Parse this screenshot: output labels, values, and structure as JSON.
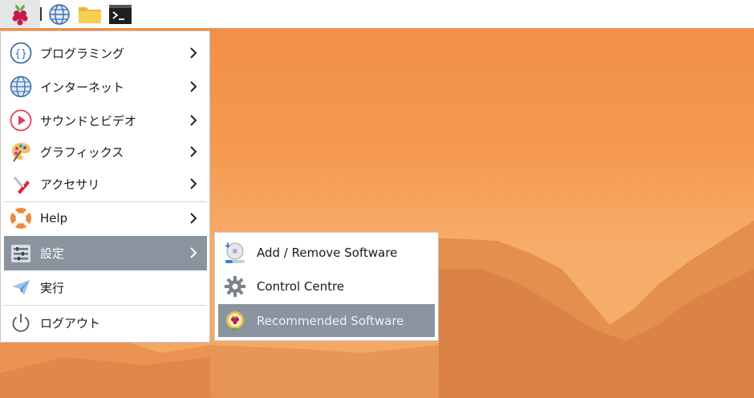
{
  "taskbar": {
    "launchers": [
      {
        "name": "web-browser"
      },
      {
        "name": "file-manager"
      },
      {
        "name": "terminal"
      }
    ]
  },
  "main_menu": {
    "items": [
      {
        "label": "プログラミング",
        "icon": "code-braces-icon",
        "submenu": true
      },
      {
        "label": "インターネット",
        "icon": "globe-icon",
        "submenu": true
      },
      {
        "label": "サウンドとビデオ",
        "icon": "play-icon",
        "submenu": true
      },
      {
        "label": "グラフィックス",
        "icon": "palette-icon",
        "submenu": true
      },
      {
        "label": "アクセサリ",
        "icon": "pocket-knife-icon",
        "submenu": true
      },
      {
        "label": "Help",
        "icon": "lifebuoy-icon",
        "submenu": true
      },
      {
        "label": "設定",
        "icon": "settings-panel-icon",
        "submenu": true,
        "active": true
      },
      {
        "label": "実行",
        "icon": "paper-plane-icon",
        "submenu": false
      },
      {
        "label": "ログアウト",
        "icon": "power-icon",
        "submenu": false
      }
    ]
  },
  "settings_submenu": {
    "items": [
      {
        "label": "Add / Remove Software",
        "icon": "software-install-icon"
      },
      {
        "label": "Control Centre",
        "icon": "gear-icon"
      },
      {
        "label": "Recommended Software",
        "icon": "raspberry-badge-icon",
        "active": true
      }
    ]
  },
  "colors": {
    "highlight": "#8a949e",
    "desktop_sky": "#f59a52"
  }
}
